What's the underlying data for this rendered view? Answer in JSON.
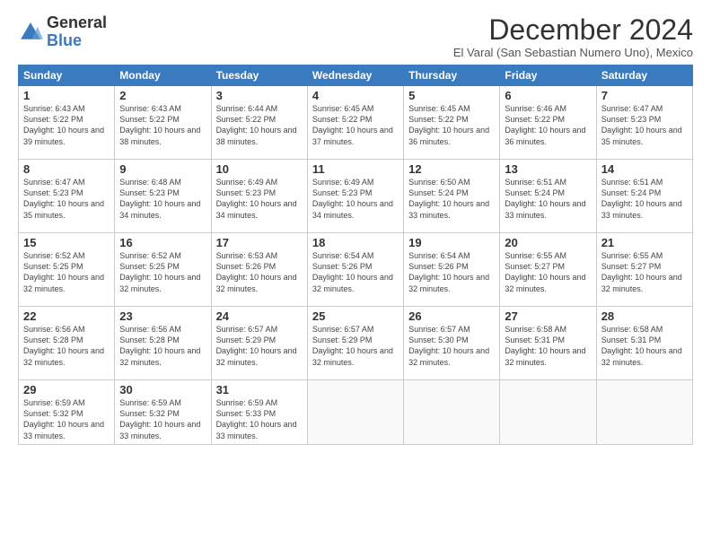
{
  "header": {
    "logo_general": "General",
    "logo_blue": "Blue",
    "month_title": "December 2024",
    "subtitle": "El Varal (San Sebastian Numero Uno), Mexico"
  },
  "days_of_week": [
    "Sunday",
    "Monday",
    "Tuesday",
    "Wednesday",
    "Thursday",
    "Friday",
    "Saturday"
  ],
  "weeks": [
    [
      {
        "day": "1",
        "sunrise": "6:43 AM",
        "sunset": "5:22 PM",
        "daylight": "10 hours and 39 minutes."
      },
      {
        "day": "2",
        "sunrise": "6:43 AM",
        "sunset": "5:22 PM",
        "daylight": "10 hours and 38 minutes."
      },
      {
        "day": "3",
        "sunrise": "6:44 AM",
        "sunset": "5:22 PM",
        "daylight": "10 hours and 38 minutes."
      },
      {
        "day": "4",
        "sunrise": "6:45 AM",
        "sunset": "5:22 PM",
        "daylight": "10 hours and 37 minutes."
      },
      {
        "day": "5",
        "sunrise": "6:45 AM",
        "sunset": "5:22 PM",
        "daylight": "10 hours and 36 minutes."
      },
      {
        "day": "6",
        "sunrise": "6:46 AM",
        "sunset": "5:22 PM",
        "daylight": "10 hours and 36 minutes."
      },
      {
        "day": "7",
        "sunrise": "6:47 AM",
        "sunset": "5:23 PM",
        "daylight": "10 hours and 35 minutes."
      }
    ],
    [
      {
        "day": "8",
        "sunrise": "6:47 AM",
        "sunset": "5:23 PM",
        "daylight": "10 hours and 35 minutes."
      },
      {
        "day": "9",
        "sunrise": "6:48 AM",
        "sunset": "5:23 PM",
        "daylight": "10 hours and 34 minutes."
      },
      {
        "day": "10",
        "sunrise": "6:49 AM",
        "sunset": "5:23 PM",
        "daylight": "10 hours and 34 minutes."
      },
      {
        "day": "11",
        "sunrise": "6:49 AM",
        "sunset": "5:23 PM",
        "daylight": "10 hours and 34 minutes."
      },
      {
        "day": "12",
        "sunrise": "6:50 AM",
        "sunset": "5:24 PM",
        "daylight": "10 hours and 33 minutes."
      },
      {
        "day": "13",
        "sunrise": "6:51 AM",
        "sunset": "5:24 PM",
        "daylight": "10 hours and 33 minutes."
      },
      {
        "day": "14",
        "sunrise": "6:51 AM",
        "sunset": "5:24 PM",
        "daylight": "10 hours and 33 minutes."
      }
    ],
    [
      {
        "day": "15",
        "sunrise": "6:52 AM",
        "sunset": "5:25 PM",
        "daylight": "10 hours and 32 minutes."
      },
      {
        "day": "16",
        "sunrise": "6:52 AM",
        "sunset": "5:25 PM",
        "daylight": "10 hours and 32 minutes."
      },
      {
        "day": "17",
        "sunrise": "6:53 AM",
        "sunset": "5:26 PM",
        "daylight": "10 hours and 32 minutes."
      },
      {
        "day": "18",
        "sunrise": "6:54 AM",
        "sunset": "5:26 PM",
        "daylight": "10 hours and 32 minutes."
      },
      {
        "day": "19",
        "sunrise": "6:54 AM",
        "sunset": "5:26 PM",
        "daylight": "10 hours and 32 minutes."
      },
      {
        "day": "20",
        "sunrise": "6:55 AM",
        "sunset": "5:27 PM",
        "daylight": "10 hours and 32 minutes."
      },
      {
        "day": "21",
        "sunrise": "6:55 AM",
        "sunset": "5:27 PM",
        "daylight": "10 hours and 32 minutes."
      }
    ],
    [
      {
        "day": "22",
        "sunrise": "6:56 AM",
        "sunset": "5:28 PM",
        "daylight": "10 hours and 32 minutes."
      },
      {
        "day": "23",
        "sunrise": "6:56 AM",
        "sunset": "5:28 PM",
        "daylight": "10 hours and 32 minutes."
      },
      {
        "day": "24",
        "sunrise": "6:57 AM",
        "sunset": "5:29 PM",
        "daylight": "10 hours and 32 minutes."
      },
      {
        "day": "25",
        "sunrise": "6:57 AM",
        "sunset": "5:29 PM",
        "daylight": "10 hours and 32 minutes."
      },
      {
        "day": "26",
        "sunrise": "6:57 AM",
        "sunset": "5:30 PM",
        "daylight": "10 hours and 32 minutes."
      },
      {
        "day": "27",
        "sunrise": "6:58 AM",
        "sunset": "5:31 PM",
        "daylight": "10 hours and 32 minutes."
      },
      {
        "day": "28",
        "sunrise": "6:58 AM",
        "sunset": "5:31 PM",
        "daylight": "10 hours and 32 minutes."
      }
    ],
    [
      {
        "day": "29",
        "sunrise": "6:59 AM",
        "sunset": "5:32 PM",
        "daylight": "10 hours and 33 minutes."
      },
      {
        "day": "30",
        "sunrise": "6:59 AM",
        "sunset": "5:32 PM",
        "daylight": "10 hours and 33 minutes."
      },
      {
        "day": "31",
        "sunrise": "6:59 AM",
        "sunset": "5:33 PM",
        "daylight": "10 hours and 33 minutes."
      },
      null,
      null,
      null,
      null
    ]
  ]
}
